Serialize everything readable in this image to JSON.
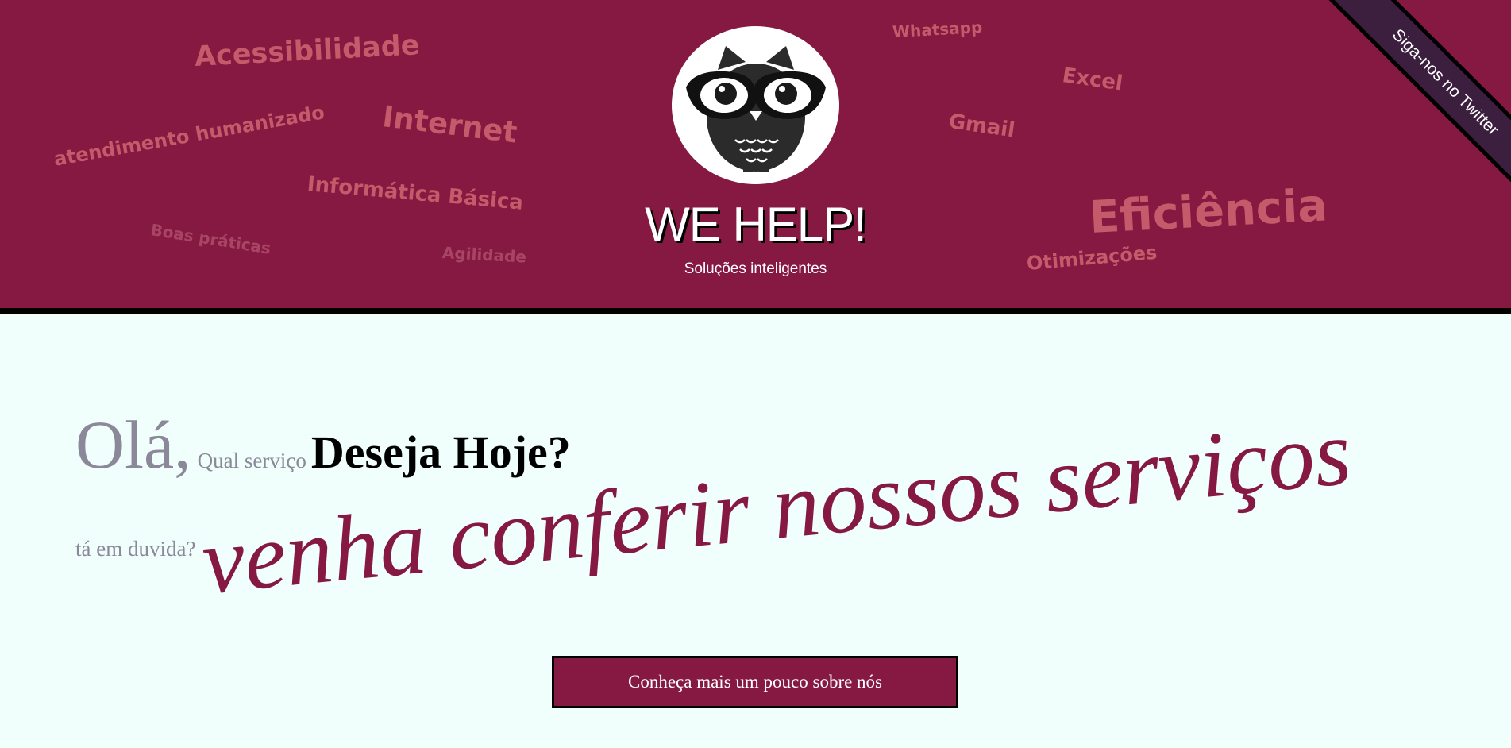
{
  "header": {
    "brand": "WE HELP!",
    "tagline": "Soluções inteligentes",
    "twitter_ribbon": "Siga-nos no Twitter",
    "tags": [
      "Acessibilidade",
      "Internet",
      "atendimento humanizado",
      "Informática Básica",
      "Boas práticas",
      "Agilidade",
      "Whatsapp",
      "Excel",
      "Gmail",
      "Eficiência",
      "Otimizações"
    ]
  },
  "main": {
    "greeting": "Olá,",
    "question_small": "Qual serviço",
    "question_bold": "Deseja Hoje?",
    "doubt": "tá em duvida?",
    "headline": "venha conferir nossos serviços",
    "cta_label": "Conheça mais um pouco sobre nós"
  },
  "colors": {
    "brand": "#861942",
    "background": "#f0fffc",
    "tag": "#c45a6a",
    "ribbon": "#3c1f3f"
  },
  "icons": {
    "logo": "owl-with-glasses-icon"
  }
}
